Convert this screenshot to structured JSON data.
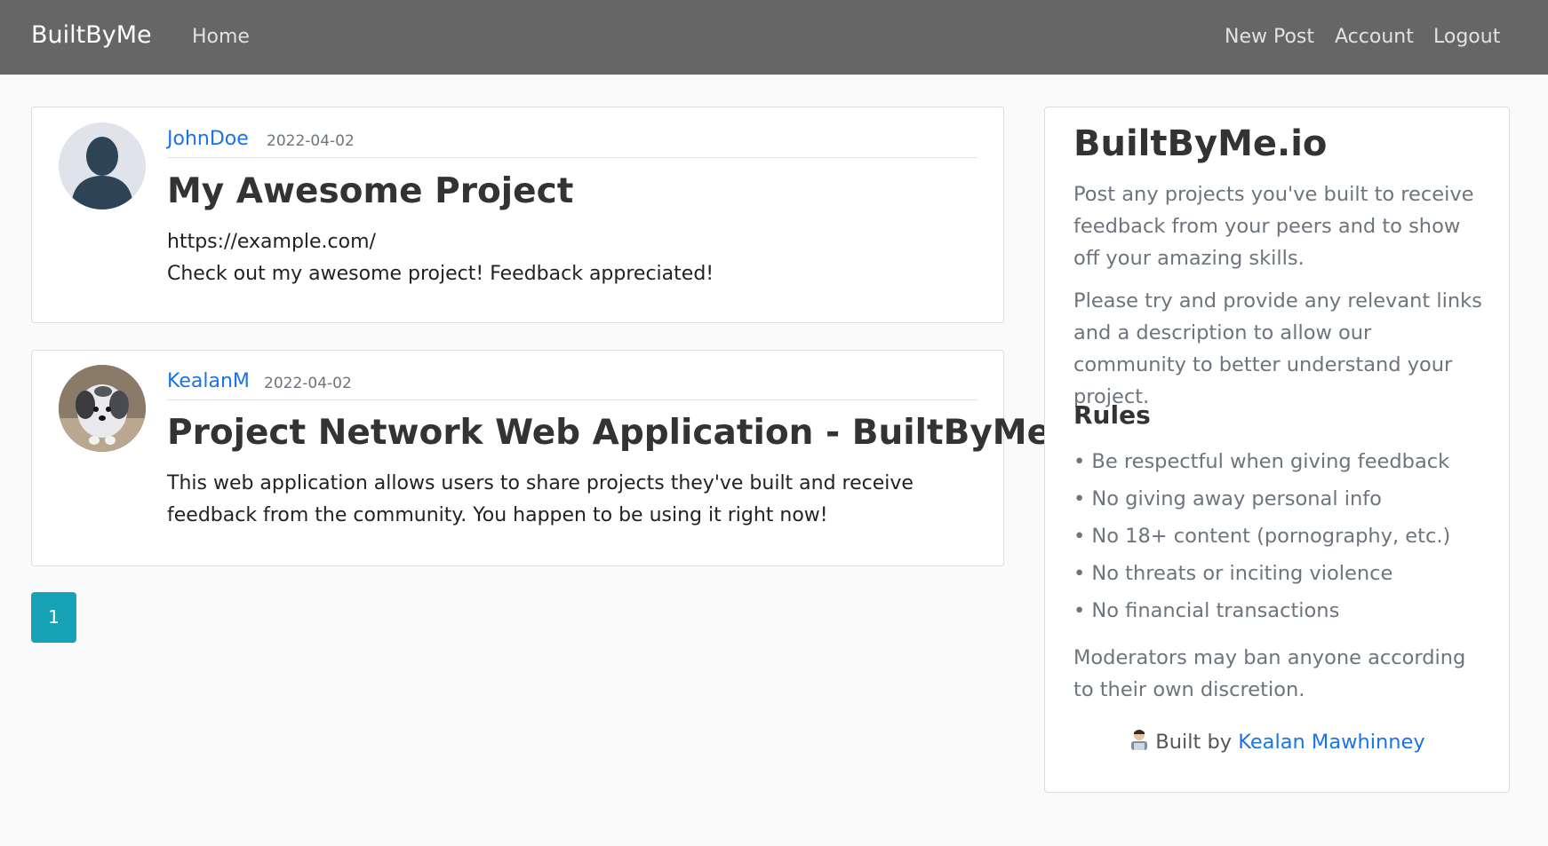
{
  "nav": {
    "brand": "BuiltByMe",
    "home": "Home",
    "new_post": "New Post",
    "account": "Account",
    "logout": "Logout"
  },
  "posts": [
    {
      "author": "JohnDoe",
      "date": "2022-04-02",
      "title": "My Awesome Project",
      "lines": [
        "https://example.com/",
        "Check out my awesome project! Feedback appreciated!"
      ],
      "avatar": "default-avatar-icon"
    },
    {
      "author": "KealanM",
      "date": "2022-04-02",
      "title": "Project Network Web Application - BuiltByMe.io",
      "text": "This web application allows users to share projects they've built and receive feedback from the community. You happen to be using it right now!",
      "avatar": "dog-photo"
    }
  ],
  "pagination": {
    "current": "1"
  },
  "sidebar": {
    "title": "BuiltByMe.io",
    "intro1": "Post any projects you've built to receive feedback from your peers and to show off your amazing skills.",
    "intro2": "Please try and provide any relevant links and a description to allow our community to better understand your project.",
    "rules_title": "Rules",
    "rules": [
      "• Be respectful when giving feedback",
      "• No giving away personal info",
      "• No 18+ content (pornography, etc.)",
      "• No threats or inciting violence",
      "• No financial transactions"
    ],
    "moderation": "Moderators may ban anyone according to their own discretion.",
    "built_by_prefix": "Built by",
    "built_by_name": "Kealan Mawhinney",
    "built_by_icon": "technologist-emoji"
  },
  "colors": {
    "navbar": "#666666",
    "link": "#1a73e8",
    "page_button": "#17a2b8",
    "background": "#fafafa"
  }
}
